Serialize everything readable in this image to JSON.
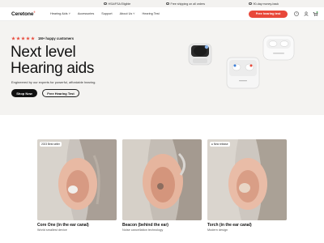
{
  "topbar": {
    "items": [
      {
        "label": "HSA/FSA Eligible"
      },
      {
        "label": "Free shipping on all orders"
      },
      {
        "label": "90-day money-back"
      }
    ]
  },
  "nav": {
    "logo": "Ceretone",
    "menu": [
      "Hearing Aids ˅",
      "Accessories",
      "Support",
      "About Us ˅",
      "Hearing Test"
    ],
    "cta": "Free hearing test"
  },
  "hero": {
    "rating_text": "1M+ happy customers",
    "headline_line1": "Next level",
    "headline_line2": "Hearing aids",
    "subtext": "Engineered by our experts for powerful, affordable hearing.",
    "primary_button": "Shop Now",
    "secondary_button": "Free Hearing Test"
  },
  "products": [
    {
      "badge": "2023 Best seller",
      "title": "Core One (in the ear canal)",
      "subtitle": "World smallest device"
    },
    {
      "badge": "",
      "title": "Beacon (behind the ear)",
      "subtitle": "Noise cancellation technology"
    },
    {
      "badge": "New release",
      "title": "Torch (in the ear canal)",
      "subtitle": "Modern design"
    }
  ],
  "colors": {
    "accent": "#e8483a",
    "hero_bg": "#f4f3f1",
    "topbar_bg": "#f3f2f0"
  }
}
